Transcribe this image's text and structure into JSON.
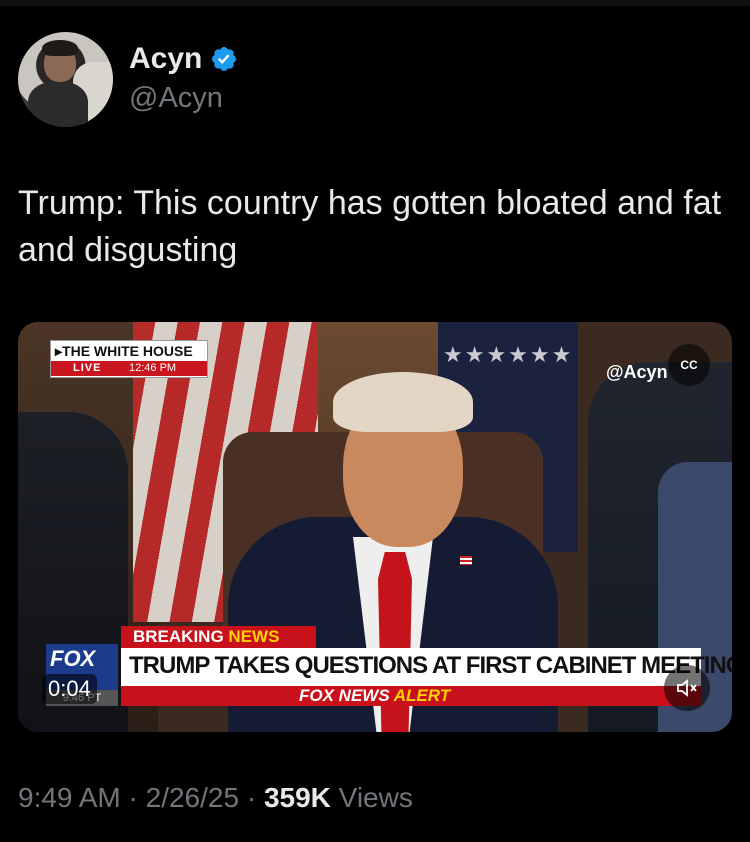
{
  "author": {
    "name": "Acyn",
    "handle": "@Acyn",
    "verified_color": "#1d9bf0"
  },
  "tweet": {
    "text": "Trump: This country has gotten bloated and fat and disgusting"
  },
  "video": {
    "network_label": "THE WHITE HOUSE",
    "live_label": "LIVE",
    "live_time": "12:46 PM",
    "watermark_handle": "@Acyn",
    "breaking_prefix": "BREAKING",
    "breaking_suffix": "NEWS",
    "headline": "TRUMP TAKES QUESTIONS AT FIRST CABINET MEETING",
    "alert_prefix": "FOX NEWS",
    "alert_suffix": "ALERT",
    "channel_logo_text": "FOX",
    "channel_time": "9:46 PT",
    "duration": "0:04",
    "cc_icon": "captions-icon",
    "mute_icon": "speaker-muted-icon"
  },
  "meta": {
    "time": "9:49 AM",
    "separator": " · ",
    "date": "2/26/25",
    "views_count": "359K",
    "views_label": " Views"
  },
  "colors": {
    "background": "#000000",
    "text_primary": "#e7e9ea",
    "text_secondary": "#71767b",
    "fox_red": "#c8111b",
    "fox_yellow": "#ffd200"
  }
}
